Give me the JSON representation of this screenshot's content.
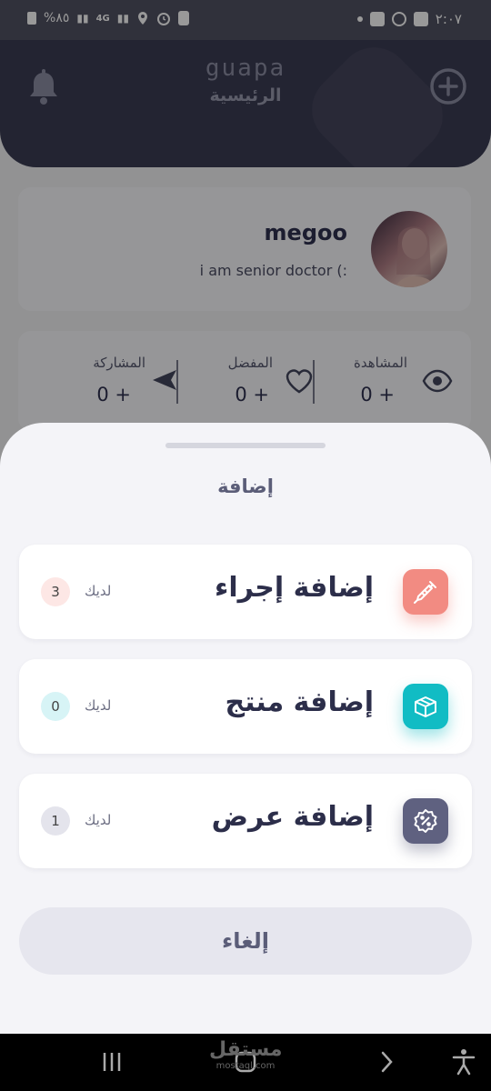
{
  "status_bar": {
    "time": "٢:٠٧",
    "battery": "%٨٥",
    "network": "4G"
  },
  "header": {
    "logo": "guapa",
    "title": "الرئيسية"
  },
  "profile": {
    "name": "megoo",
    "bio": "i am senior doctor (:"
  },
  "stats": [
    {
      "label": "المشاهدة",
      "value": "0 +",
      "icon": "eye-icon"
    },
    {
      "label": "المفضل",
      "value": "0 +",
      "icon": "heart-icon"
    },
    {
      "label": "المشاركة",
      "value": "0 +",
      "icon": "send-icon"
    }
  ],
  "sheet": {
    "title": "إضافة",
    "options": [
      {
        "label": "إضافة إجراء",
        "have_label": "لديك",
        "count": "3",
        "icon": "syringe-icon",
        "icon_color": "#f28b82",
        "badge_color": "#fde7e5"
      },
      {
        "label": "إضافة منتج",
        "have_label": "لديك",
        "count": "0",
        "icon": "box-icon",
        "icon_color": "#11bcc4",
        "badge_color": "#d7f4f6"
      },
      {
        "label": "إضافة عرض",
        "have_label": "لديك",
        "count": "1",
        "icon": "discount-badge-icon",
        "icon_color": "#5f6180",
        "badge_color": "#e4e4ec"
      }
    ],
    "cancel_label": "إلغاء"
  },
  "watermark": {
    "text": "مستقل",
    "url": "mostaql.com"
  }
}
